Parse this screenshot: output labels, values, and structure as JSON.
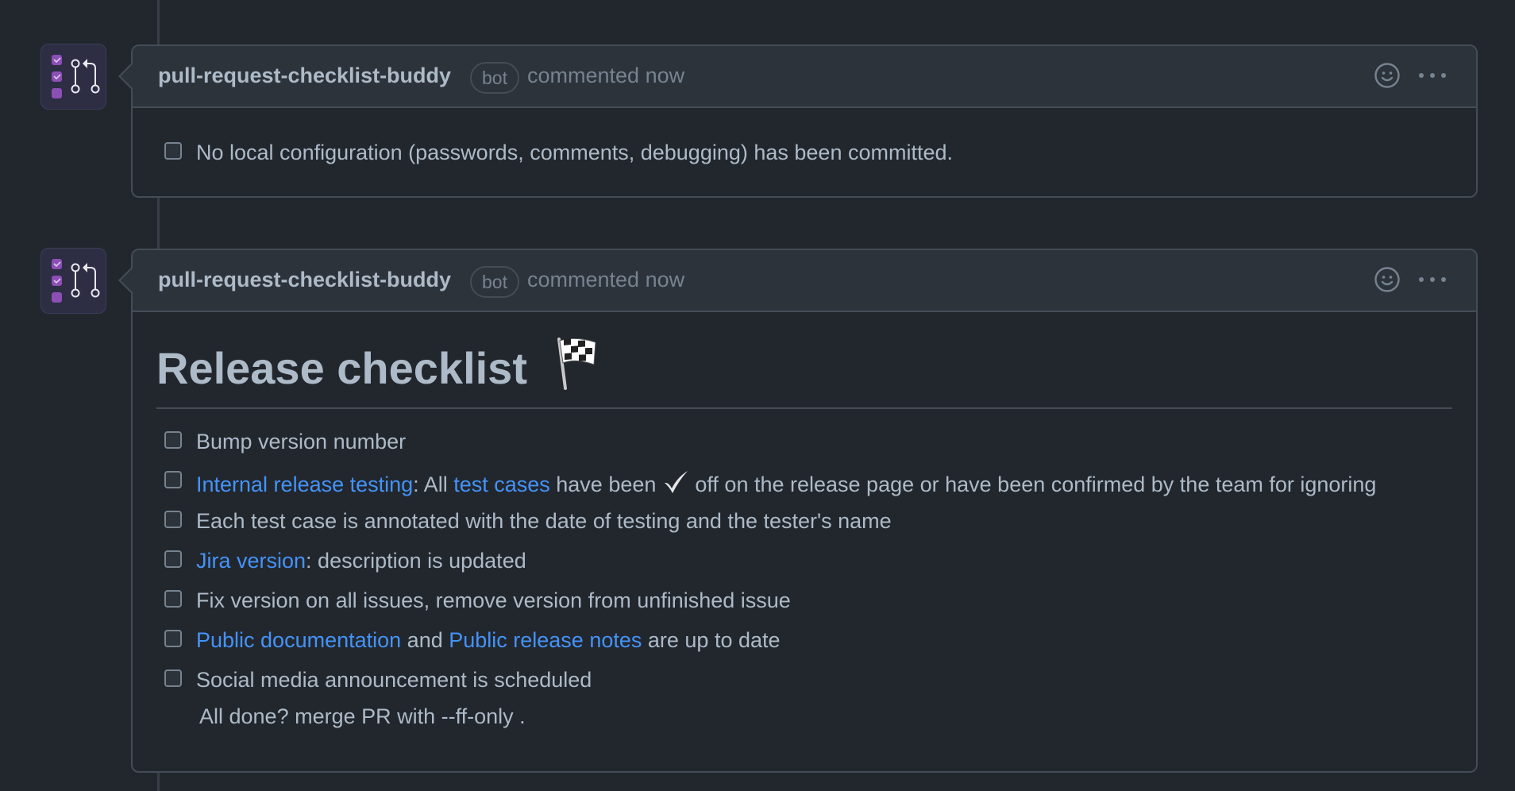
{
  "comments": [
    {
      "author": "pull-request-checklist-buddy",
      "badge": "bot",
      "meta": "commented now",
      "tasks": [
        {
          "text": "No local configuration (passwords, comments, debugging) has been committed."
        }
      ]
    },
    {
      "author": "pull-request-checklist-buddy",
      "badge": "bot",
      "meta": "commented now",
      "heading": "Release checklist",
      "heading_icon": "checkered-flag-icon",
      "tasks": {
        "bump": "Bump version number",
        "internal_link": "Internal release testing",
        "internal_sep": ": All ",
        "test_cases_link": "test cases",
        "internal_mid": " have been ",
        "internal_end": " off on the release page or have been confirmed by the team for ignoring",
        "annotated": "Each test case is annotated with the date of testing and the tester's name",
        "jira_link": "Jira version",
        "jira_rest": ": description is updated",
        "fix_version": "Fix version on all issues, remove version from unfinished issue",
        "public_docs_link": "Public documentation",
        "and": " and ",
        "public_notes_link": "Public release notes",
        "up_to_date": " are up to date",
        "social": "Social media announcement is scheduled"
      },
      "footer": "All done? merge PR with --ff-only ."
    }
  ],
  "icons": {
    "smiley": "smiley-icon",
    "kebab": "kebab-horizontal-icon",
    "check": "heavy-check-mark-icon"
  },
  "colors": {
    "background": "#22272e",
    "header": "#2d333b",
    "link": "#4493f8",
    "text": "#adbac7",
    "muted": "#768390"
  }
}
